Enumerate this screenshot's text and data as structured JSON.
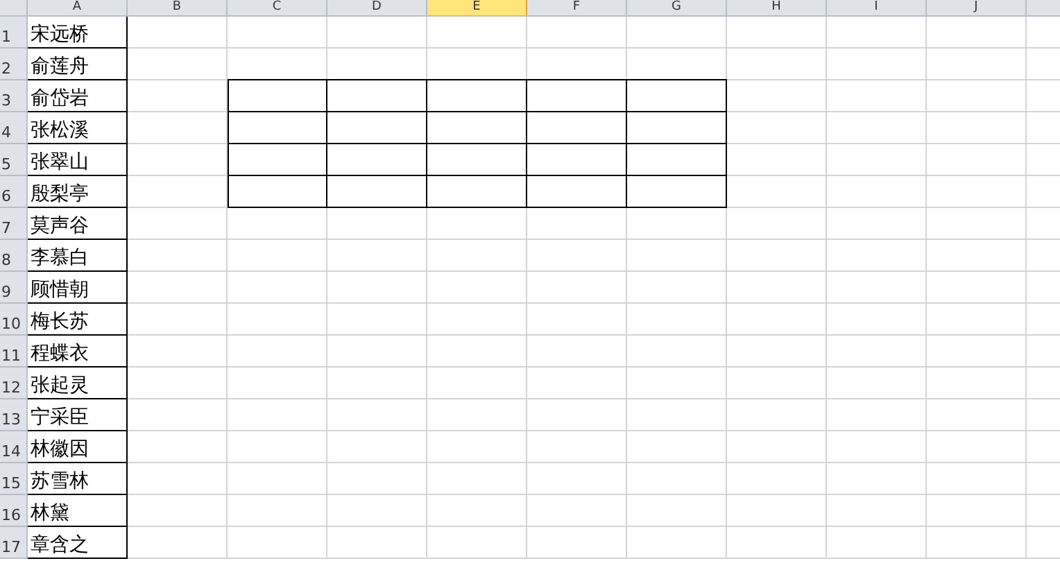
{
  "columns": [
    {
      "label": "A",
      "selected": false
    },
    {
      "label": "B",
      "selected": false
    },
    {
      "label": "C",
      "selected": false
    },
    {
      "label": "D",
      "selected": false
    },
    {
      "label": "E",
      "selected": true
    },
    {
      "label": "F",
      "selected": false
    },
    {
      "label": "G",
      "selected": false
    },
    {
      "label": "H",
      "selected": false
    },
    {
      "label": "I",
      "selected": false
    },
    {
      "label": "J",
      "selected": false
    }
  ],
  "rows": [
    {
      "number": "1",
      "name": "宋远桥",
      "boxed": false
    },
    {
      "number": "2",
      "name": "俞莲舟",
      "boxed": false
    },
    {
      "number": "3",
      "name": "俞岱岩",
      "boxed": true
    },
    {
      "number": "4",
      "name": "张松溪",
      "boxed": true
    },
    {
      "number": "5",
      "name": "张翠山",
      "boxed": true
    },
    {
      "number": "6",
      "name": "殷梨亭",
      "boxed": true
    },
    {
      "number": "7",
      "name": "莫声谷",
      "boxed": false
    },
    {
      "number": "8",
      "name": "李慕白",
      "boxed": false
    },
    {
      "number": "9",
      "name": "顾惜朝",
      "boxed": false
    },
    {
      "number": "10",
      "name": "梅长苏",
      "boxed": false
    },
    {
      "number": "11",
      "name": "程蝶衣",
      "boxed": false
    },
    {
      "number": "12",
      "name": "张起灵",
      "boxed": false
    },
    {
      "number": "13",
      "name": "宁采臣",
      "boxed": false
    },
    {
      "number": "14",
      "name": "林徽因",
      "boxed": false
    },
    {
      "number": "15",
      "name": "苏雪林",
      "boxed": false
    },
    {
      "number": "16",
      "name": "林黛",
      "boxed": false
    },
    {
      "number": "17",
      "name": "章含之",
      "boxed": false
    }
  ]
}
